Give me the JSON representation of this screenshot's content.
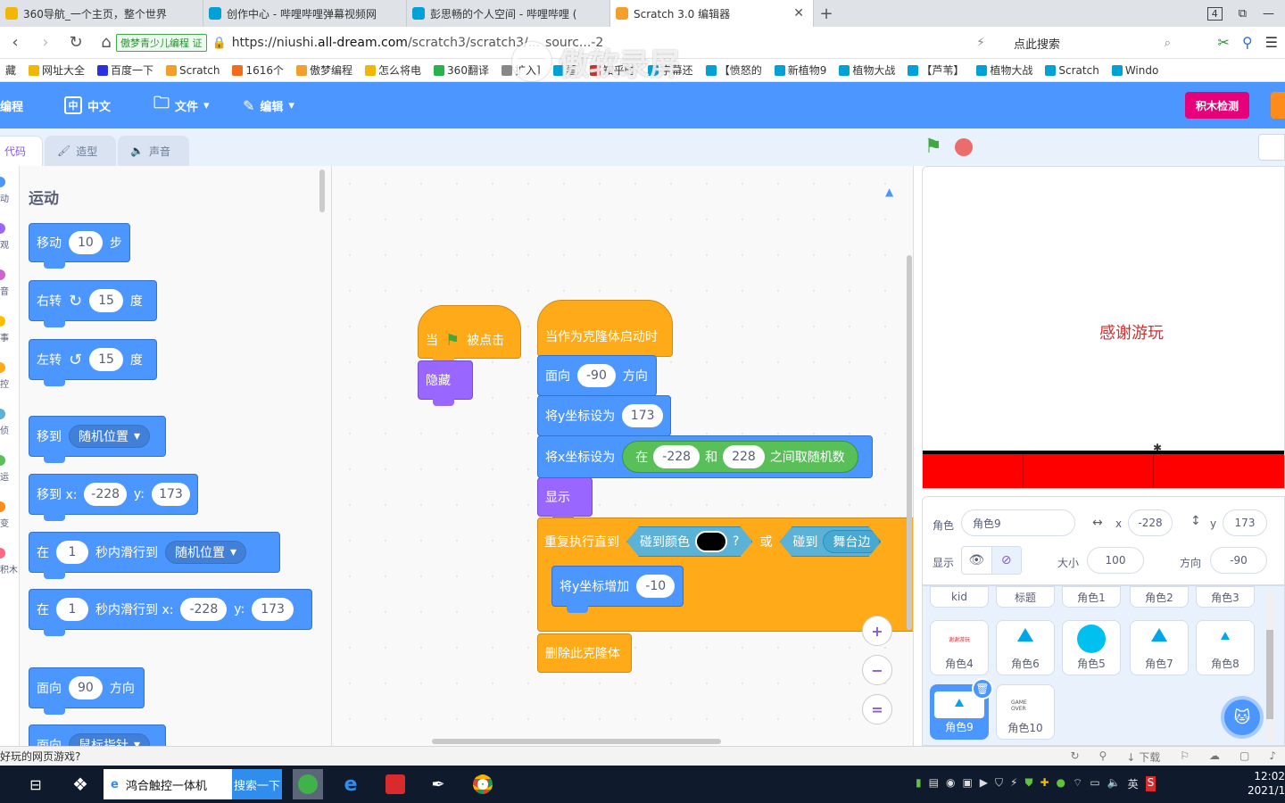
{
  "browser": {
    "tabs": [
      {
        "title": "360导航_一个主页，整个世界",
        "color": "#f2b705",
        "active": false
      },
      {
        "title": "创作中心 - 哔哩哔哩弹幕视频网",
        "color": "#00a1d6",
        "active": false
      },
      {
        "title": "彭思畅的个人空间 - 哔哩哔哩 (",
        "color": "#00a1d6",
        "active": false
      },
      {
        "title": "Scratch 3.0 编辑器",
        "color": "#f2a02b",
        "active": true
      }
    ],
    "tab_count": "4",
    "safe_badge": "傲梦青少儿编程",
    "safe_mark": "证",
    "url_prefix": "https://niushi.",
    "url_domain": "all-dream.com",
    "url_path": "/scratch3/scratch3/...",
    "url_tail": "sourc...-2",
    "search_placeholder": "点此搜索",
    "bookmarks": [
      {
        "label": "藏",
        "color": "#888888"
      },
      {
        "label": "网址大全",
        "color": "#f2b705"
      },
      {
        "label": "百度一下",
        "color": "#2932e1"
      },
      {
        "label": "Scratch",
        "color": "#f2a02b"
      },
      {
        "label": "1616个",
        "color": "#f46b1a"
      },
      {
        "label": "傲梦编程",
        "color": "#f2a02b"
      },
      {
        "label": "怎么将电",
        "color": "#f2b705"
      },
      {
        "label": "360翻译",
        "color": "#2ab24a"
      },
      {
        "label": "扩入]",
        "color": "#888888"
      },
      {
        "label": "看",
        "color": "#00a1d6"
      },
      {
        "label": "知乎时",
        "color": "#c9302c"
      },
      {
        "label": "字幕还",
        "color": "#00a1d6"
      },
      {
        "label": "【愤怒的",
        "color": "#00a1d6"
      },
      {
        "label": "新植物9",
        "color": "#00a1d6"
      },
      {
        "label": "植物大战",
        "color": "#00a1d6"
      },
      {
        "label": "【芦苇】",
        "color": "#00a1d6"
      },
      {
        "label": "植物大战",
        "color": "#00a1d6"
      },
      {
        "label": "Scratch",
        "color": "#00a1d6"
      },
      {
        "label": "Windo",
        "color": "#00a1d6"
      }
    ]
  },
  "menu": {
    "logo": "编程",
    "language": "中文",
    "language_icon": "中",
    "file": "文件",
    "edit": "编辑",
    "check_button": "积木检测"
  },
  "editor_tabs": {
    "code": "代码",
    "costumes": "造型",
    "sounds": "声音"
  },
  "categories": [
    {
      "label": "动",
      "color": "#4c97ff"
    },
    {
      "label": "观",
      "color": "#9966ff"
    },
    {
      "label": "音",
      "color": "#cf63cf"
    },
    {
      "label": "事",
      "color": "#ffbf00"
    },
    {
      "label": "控",
      "color": "#ffab19"
    },
    {
      "label": "侦",
      "color": "#5cb1d6"
    },
    {
      "label": "运",
      "color": "#59c059"
    },
    {
      "label": "变",
      "color": "#ff8c1a"
    },
    {
      "label": "积木",
      "color": "#ff6680"
    }
  ],
  "palette": {
    "title": "运动",
    "move": {
      "pre": "移动",
      "value": "10",
      "post": "步"
    },
    "turn_right": {
      "pre": "右转",
      "value": "15",
      "post": "度"
    },
    "turn_left": {
      "pre": "左转",
      "value": "15",
      "post": "度"
    },
    "goto": {
      "pre": "移到",
      "option": "随机位置"
    },
    "goto_xy": {
      "pre": "移到 x:",
      "x": "-228",
      "ylbl": "y:",
      "y": "173"
    },
    "glide": {
      "pre": "在",
      "secs": "1",
      "mid": "秒内滑行到",
      "option": "随机位置"
    },
    "glide_xy": {
      "pre": "在",
      "secs": "1",
      "mid": "秒内滑行到 x:",
      "x": "-228",
      "ylbl": "y:",
      "y": "173"
    },
    "point": {
      "pre": "面向",
      "value": "90",
      "post": "方向"
    },
    "point_towards": {
      "pre": "面向",
      "option": "鼠标指针"
    }
  },
  "script1": {
    "hat_pre": "当",
    "hat_post": "被点击",
    "hide": "隐藏"
  },
  "script2": {
    "hat": "当作为克隆体启动时",
    "point": {
      "pre": "面向",
      "value": "-90",
      "post": "方向"
    },
    "set_y": {
      "pre": "将y坐标设为",
      "value": "173"
    },
    "set_x": {
      "pre": "将x坐标设为",
      "rand_pre": "在",
      "from": "-228",
      "and": "和",
      "to": "228",
      "rand_post": "之间取随机数"
    },
    "show": "显示",
    "repeat_until": "重复执行直到",
    "touch_color": "碰到颜色",
    "q": "?",
    "or": "或",
    "touching": "碰到",
    "touching_target": "舞台边",
    "change_y": {
      "pre": "将y坐标增加",
      "value": "-10"
    },
    "delete_clone": "删除此克隆体"
  },
  "zoom": {
    "in": "+",
    "out": "−",
    "reset": "="
  },
  "stage": {
    "text": "感谢游玩"
  },
  "sprite_info": {
    "sprite_label": "角色",
    "sprite_name": "角色9",
    "x_label": "x",
    "x": "-228",
    "y_label": "y",
    "y": "173",
    "show_label": "显示",
    "size_label": "大小",
    "size": "100",
    "direction_label": "方向",
    "direction": "-90"
  },
  "sprites_row0": [
    "kid",
    "标题",
    "角色1",
    "角色2",
    "角色3"
  ],
  "sprites_row1": [
    "角色4",
    "角色6",
    "角色5",
    "角色7",
    "角色8"
  ],
  "sprites_row2": [
    "角色9",
    "角色10"
  ],
  "sprite_thumbs": {
    "title_text": "谢谢游玩",
    "gameover_text": "GAME OVER"
  },
  "status": {
    "text": "好玩的网页游戏?",
    "download": "下载"
  },
  "taskbar": {
    "search_text": "鸿合触控一体机",
    "search_button": "搜索一下",
    "tray_lang": "英",
    "time": "12:02",
    "date": "2021/1"
  }
}
